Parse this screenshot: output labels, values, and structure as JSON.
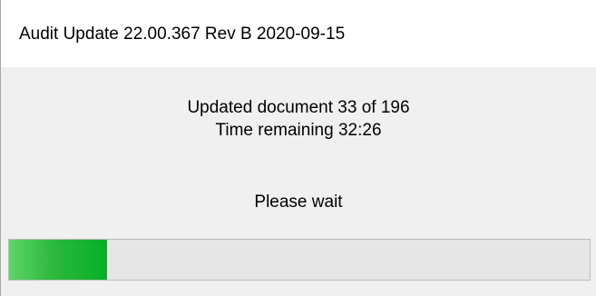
{
  "window": {
    "title": "Audit Update 22.00.367 Rev B 2020-09-15"
  },
  "status": {
    "progress_text": "Updated document 33 of 196",
    "time_remaining": "Time remaining 32:26",
    "wait_message": "Please wait"
  },
  "progress": {
    "current": 33,
    "total": 196,
    "fraction": 0.168,
    "fill_color": "#06b025"
  }
}
